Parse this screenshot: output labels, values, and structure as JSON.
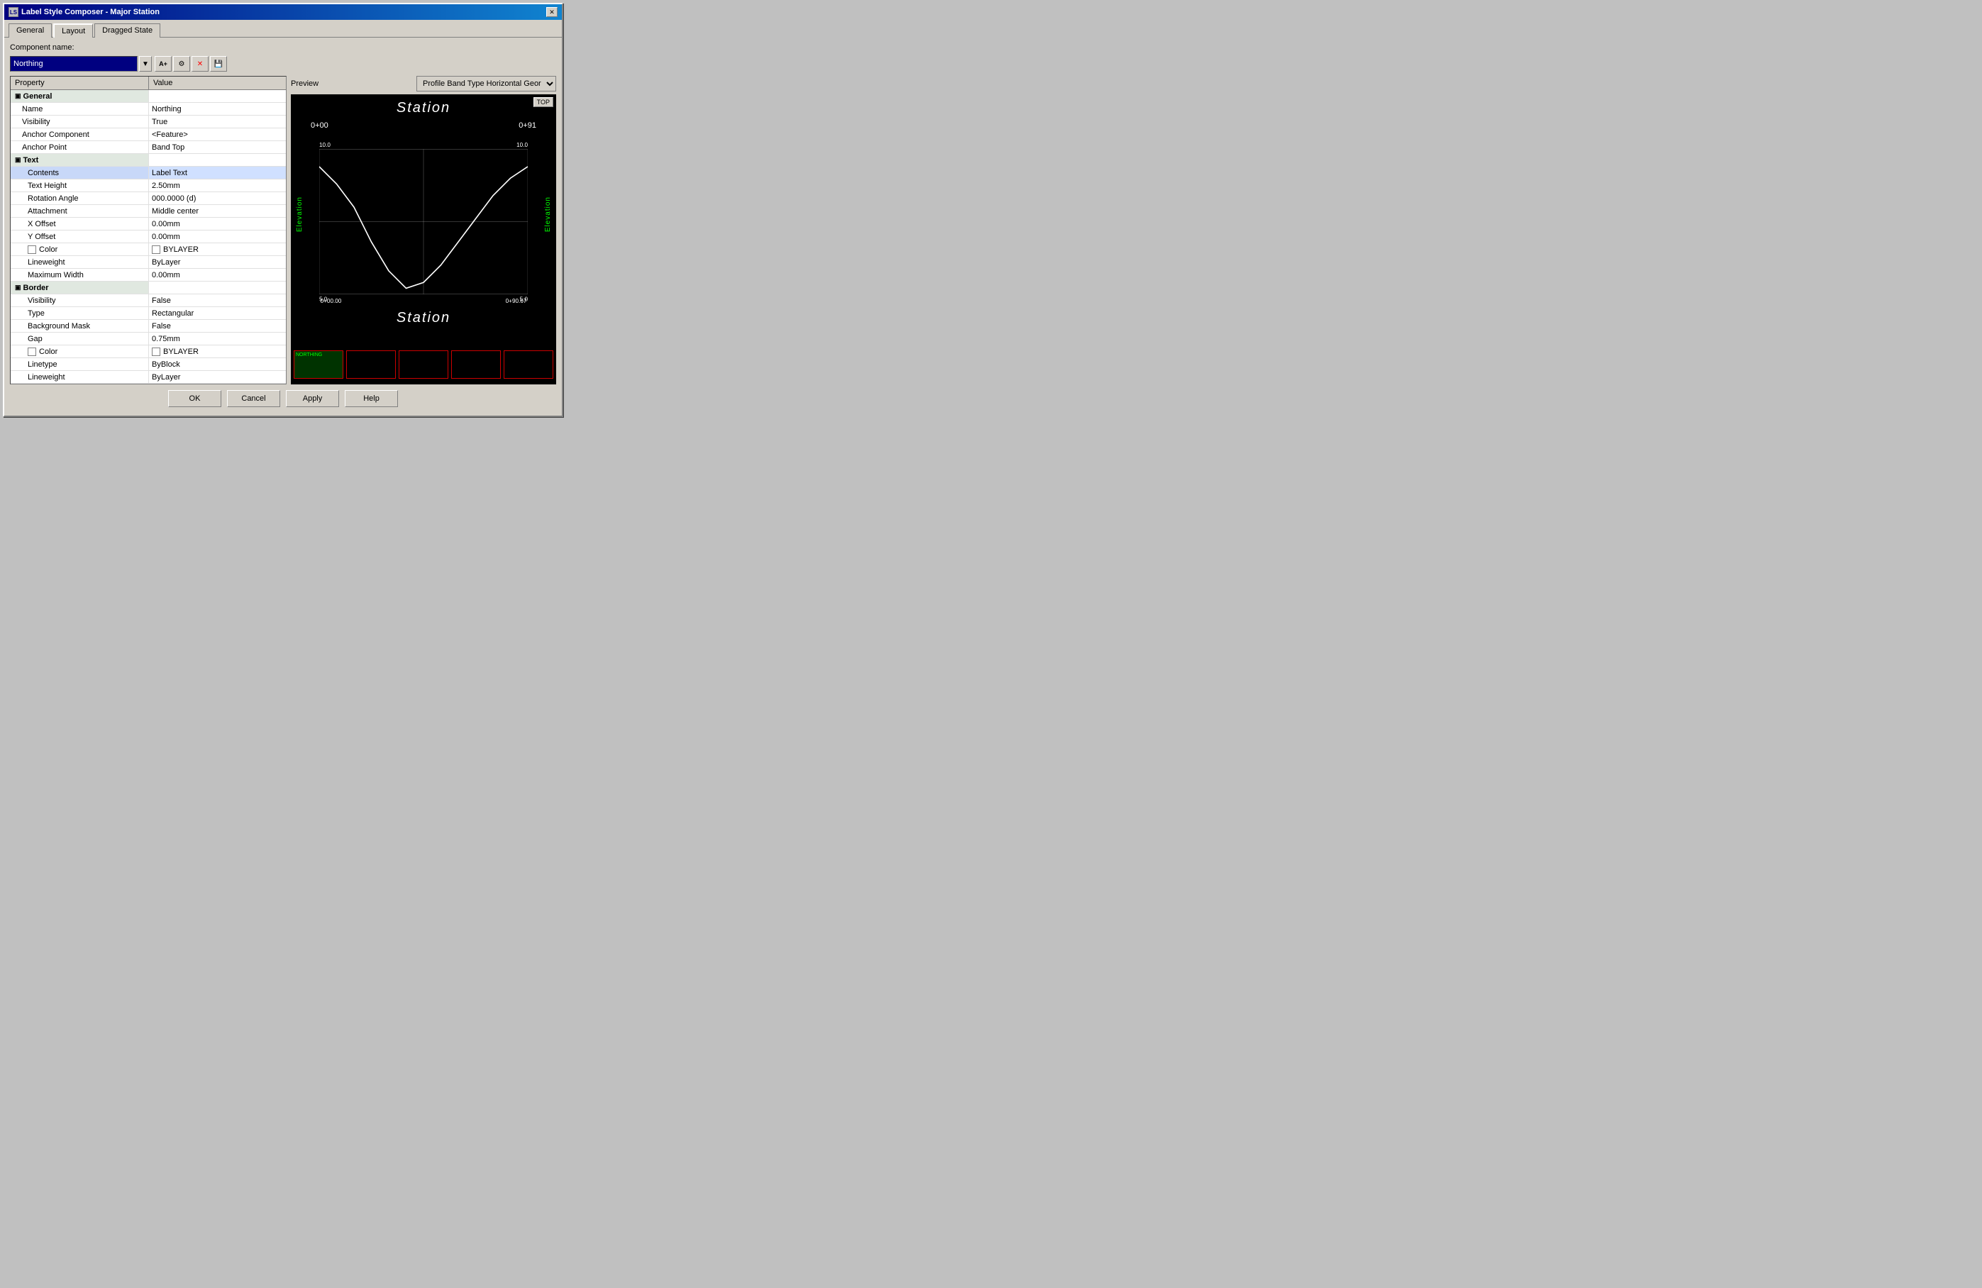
{
  "window": {
    "title": "Label Style Composer - Major Station",
    "icon_label": "LS"
  },
  "tabs": [
    {
      "label": "General",
      "active": false
    },
    {
      "label": "Layout",
      "active": true
    },
    {
      "label": "Dragged State",
      "active": false
    }
  ],
  "component_section": {
    "label": "Component name:",
    "dropdown_value": "Northing",
    "toolbar_buttons": [
      "A+",
      "🔧",
      "✕",
      "💾"
    ]
  },
  "property_table": {
    "col_property": "Property",
    "col_value": "Value",
    "sections": [
      {
        "type": "section",
        "label": "General",
        "expanded": true,
        "rows": [
          {
            "name": "Name",
            "value": "Northing",
            "indent": 1
          },
          {
            "name": "Visibility",
            "value": "True",
            "indent": 1
          },
          {
            "name": "Anchor Component",
            "value": "<Feature>",
            "indent": 1
          },
          {
            "name": "Anchor Point",
            "value": "Band Top",
            "indent": 1
          }
        ]
      },
      {
        "type": "section",
        "label": "Text",
        "expanded": true,
        "rows": [
          {
            "name": "Contents",
            "value": "Label Text",
            "indent": 2,
            "highlighted": true
          },
          {
            "name": "Text Height",
            "value": "2.50mm",
            "indent": 2
          },
          {
            "name": "Rotation Angle",
            "value": "000.0000 (d)",
            "indent": 2
          },
          {
            "name": "Attachment",
            "value": "Middle center",
            "indent": 2
          },
          {
            "name": "X Offset",
            "value": "0.00mm",
            "indent": 2
          },
          {
            "name": "Y Offset",
            "value": "0.00mm",
            "indent": 2
          },
          {
            "name": "Color",
            "value": "BYLAYER",
            "indent": 2,
            "has_checkbox": true,
            "has_swatch": true
          },
          {
            "name": "Lineweight",
            "value": "ByLayer",
            "indent": 2
          },
          {
            "name": "Maximum Width",
            "value": "0.00mm",
            "indent": 2
          }
        ]
      },
      {
        "type": "section",
        "label": "Border",
        "expanded": true,
        "rows": [
          {
            "name": "Visibility",
            "value": "False",
            "indent": 2
          },
          {
            "name": "Type",
            "value": "Rectangular",
            "indent": 2
          },
          {
            "name": "Background Mask",
            "value": "False",
            "indent": 2
          },
          {
            "name": "Gap",
            "value": "0.75mm",
            "indent": 2
          },
          {
            "name": "Color",
            "value": "BYLAYER",
            "indent": 2,
            "has_checkbox": true,
            "has_swatch": true
          },
          {
            "name": "Linetype",
            "value": "ByBlock",
            "indent": 2
          },
          {
            "name": "Lineweight",
            "value": "ByLayer",
            "indent": 2
          }
        ]
      }
    ]
  },
  "preview": {
    "label": "Preview",
    "dropdown_value": "Profile Band Type Horizontal Geor",
    "top_btn": "TOP",
    "station_top": "Station",
    "station_bottom": "Station",
    "station_left_top": "0+00",
    "station_right_top": "0+91",
    "station_left_bottom": "0+00.00",
    "station_right_bottom": "0+90.67",
    "elevation_label": "Elevation",
    "axis_values": {
      "top_left": "10.0",
      "top_right": "10.0",
      "bottom_left": "5.0",
      "bottom_right": "5.0"
    },
    "thumbnail_text": "NORTHING"
  },
  "footer": {
    "ok_label": "OK",
    "cancel_label": "Cancel",
    "apply_label": "Apply",
    "help_label": "Help"
  }
}
